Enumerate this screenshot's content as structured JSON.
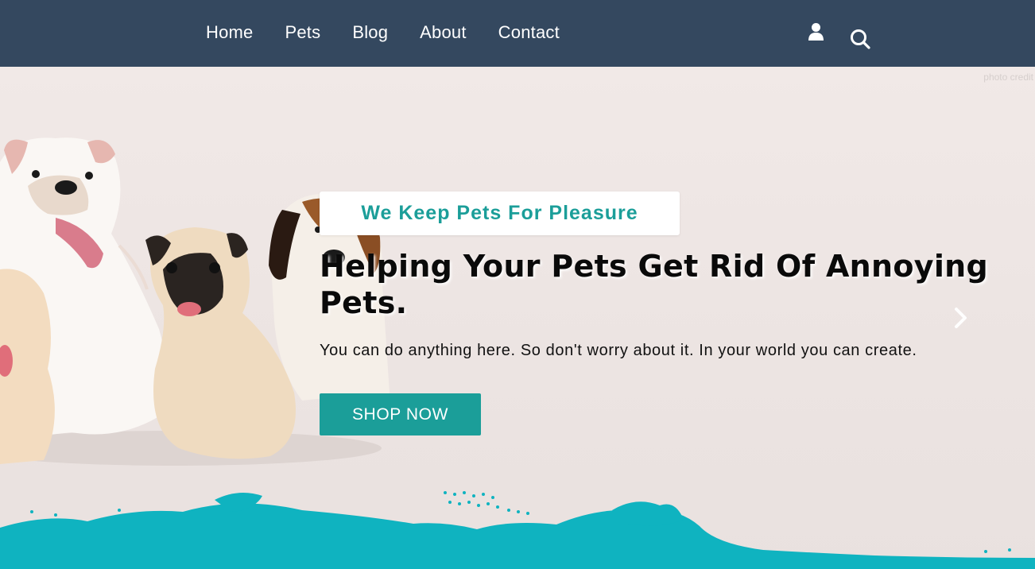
{
  "nav": {
    "items": [
      {
        "label": "Home"
      },
      {
        "label": "Pets"
      },
      {
        "label": "Blog"
      },
      {
        "label": "About"
      },
      {
        "label": "Contact"
      }
    ],
    "icons": [
      "user-icon",
      "search-icon"
    ]
  },
  "hero": {
    "photo_credit": "photo credit",
    "tagline": "We Keep Pets For Pleasure",
    "headline": "Helping Your Pets Get Rid Of Annoying Pets.",
    "subtext": "You can do anything here. So don't worry about it. In your world you can create.",
    "cta_label": "SHOP NOW",
    "next_icon": "chevron-right-icon"
  },
  "colors": {
    "navbar": "#34485f",
    "accent": "#1b9e99",
    "splash": "#0fb3c0",
    "background": "#efe8e6"
  }
}
